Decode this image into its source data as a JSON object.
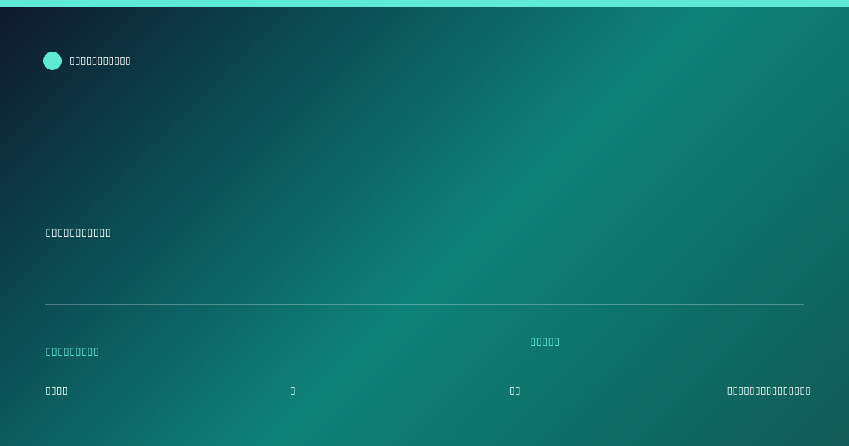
{
  "theme": {
    "accent": "#5eead4",
    "text": "#ffffff",
    "gradient_stops": [
      "#0f172a",
      "#0b4f55",
      "#0e8278",
      "#0d6e67",
      "#125a55"
    ]
  },
  "brand": {
    "icon": "teal-dot-logo",
    "name": "▯▯▯▯▯▯▯▯▯▯▯"
  },
  "headline": "▯▯▯▯▯▯▯▯▯▯▯",
  "footer": {
    "left_label": "▯▯▯▯▯▯▯▯▯",
    "mid_label": "▯▯▯▯▯",
    "meta": [
      "▯▯▯▯",
      "▯",
      "▯▯",
      "▯▯▯▯▯▯▯▯▯▯▯▯▯▯▯"
    ]
  }
}
